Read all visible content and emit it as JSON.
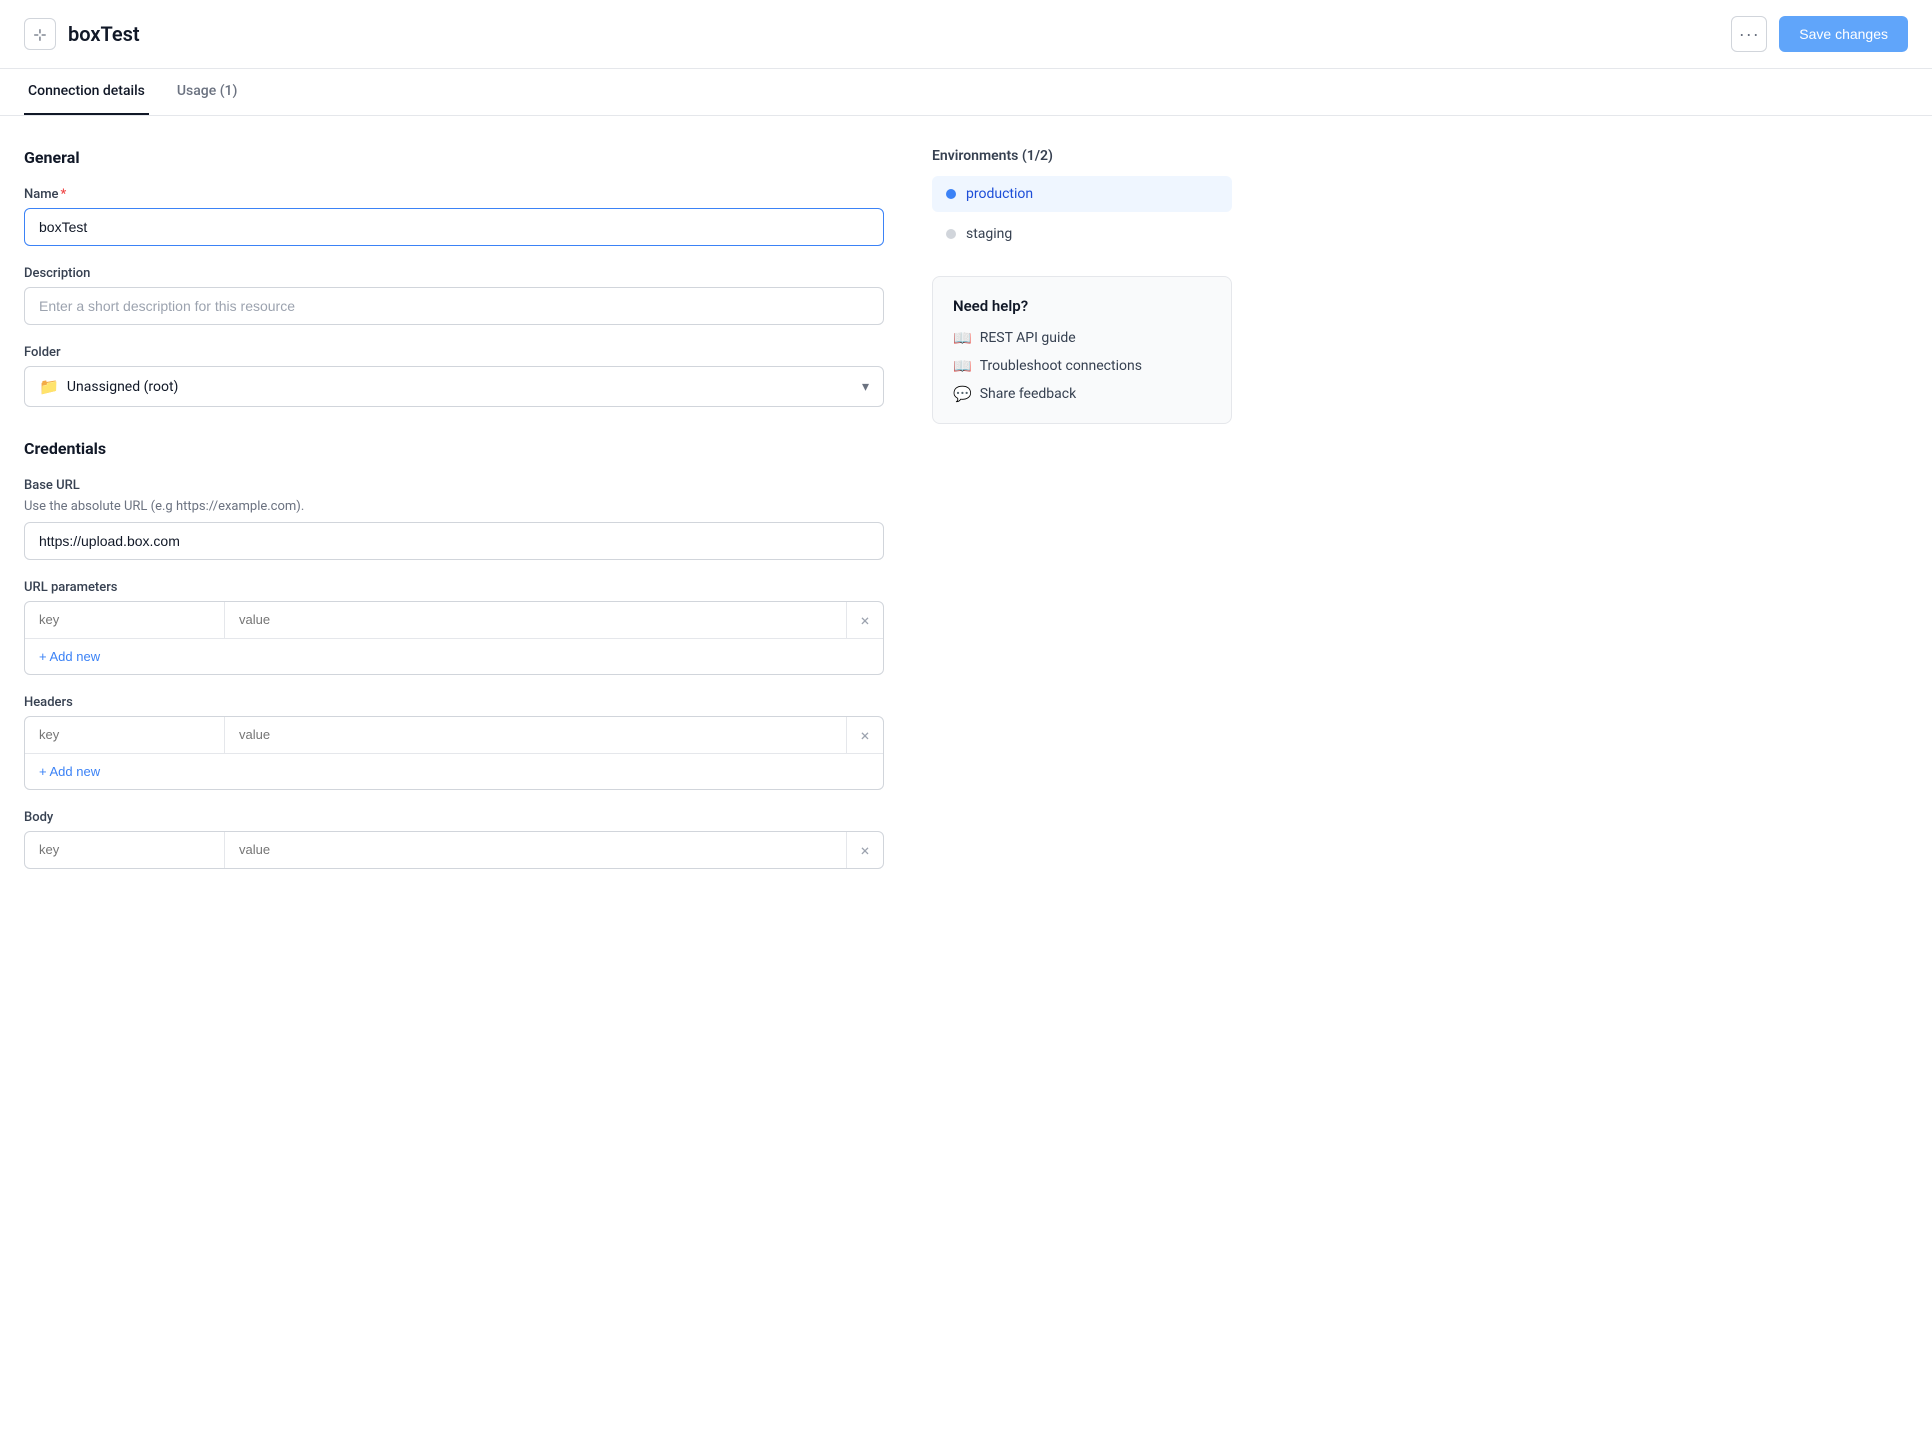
{
  "header": {
    "title": "boxTest",
    "more_label": "···",
    "save_label": "Save changes",
    "icon_symbol": "⊹"
  },
  "tabs": [
    {
      "id": "connection-details",
      "label": "Connection details",
      "active": true
    },
    {
      "id": "usage",
      "label": "Usage (1)",
      "active": false
    }
  ],
  "general": {
    "section_title": "General",
    "name_label": "Name",
    "name_value": "boxTest",
    "description_label": "Description",
    "description_placeholder": "Enter a short description for this resource",
    "folder_label": "Folder",
    "folder_value": "Unassigned (root)"
  },
  "credentials": {
    "section_title": "Credentials",
    "base_url_label": "Base URL",
    "base_url_hint": "Use the absolute URL (e.g https://example.com).",
    "base_url_value": "https://upload.box.com",
    "url_params_label": "URL parameters",
    "url_params_key_placeholder": "key",
    "url_params_value_placeholder": "value",
    "url_params_add_label": "+ Add new",
    "headers_label": "Headers",
    "headers_key_placeholder": "key",
    "headers_value_placeholder": "value",
    "headers_add_label": "+ Add new",
    "body_label": "Body",
    "body_key_placeholder": "key",
    "body_value_placeholder": "value"
  },
  "environments": {
    "title": "Environments (1/2)",
    "items": [
      {
        "id": "production",
        "label": "production",
        "active": true,
        "dot": "blue"
      },
      {
        "id": "staging",
        "label": "staging",
        "active": false,
        "dot": "gray"
      }
    ]
  },
  "help": {
    "title": "Need help?",
    "links": [
      {
        "id": "rest-api-guide",
        "label": "REST API guide",
        "icon": "📖"
      },
      {
        "id": "troubleshoot-connections",
        "label": "Troubleshoot connections",
        "icon": "📖"
      },
      {
        "id": "share-feedback",
        "label": "Share feedback",
        "icon": "💬"
      }
    ]
  }
}
